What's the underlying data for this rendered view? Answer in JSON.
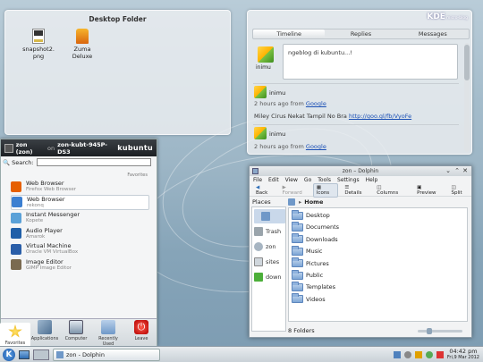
{
  "desktop_folder": {
    "title": "Desktop Folder",
    "icons": [
      {
        "label": "snapshot2.\npng",
        "name": "image-file-icon"
      },
      {
        "label": "Zuma Deluxe",
        "name": "zuma-icon"
      }
    ]
  },
  "twitter": {
    "brand": "KDE",
    "brand_sub": "micro-blog",
    "tabs": [
      "Timeline",
      "Replies",
      "Messages"
    ],
    "compose_placeholder": "ngeblog di kubuntu...!",
    "compose_user": "inimu",
    "posts": [
      {
        "user": "inimu",
        "meta_prefix": "2 hours ago from",
        "meta_source": "Google",
        "text": "Miley Cirus Nekat Tampil No Bra",
        "link": "http://goo.gl/fb/VyoFe"
      },
      {
        "user": "inimu",
        "meta_prefix": "2 hours ago from",
        "meta_source": "Google"
      }
    ]
  },
  "kickoff": {
    "user": "zon (zon)",
    "on": "on",
    "host": "zon-kubt-945P-DS3",
    "logo": "kubuntu",
    "search_label": "Search:",
    "section": "Favorites",
    "favorites": [
      {
        "title": "Web Browser",
        "sub": "Firefox Web Browser",
        "icon": "firefox-icon",
        "color": "#e66000"
      },
      {
        "title": "Web Browser",
        "sub": "rekonq",
        "icon": "rekonq-icon",
        "color": "#3b7fd1"
      },
      {
        "title": "Instant Messenger",
        "sub": "Kopete",
        "icon": "kopete-icon",
        "color": "#5aa1d8"
      },
      {
        "title": "Audio Player",
        "sub": "Amarok",
        "icon": "amarok-icon",
        "color": "#1f5fa8"
      },
      {
        "title": "Virtual Machine",
        "sub": "Oracle VM VirtualBox",
        "icon": "virtualbox-icon",
        "color": "#2a5ea8"
      },
      {
        "title": "Image Editor",
        "sub": "GIMP Image Editor",
        "icon": "gimp-icon",
        "color": "#7a6a50"
      }
    ],
    "tabs": [
      {
        "label": "Favorites",
        "icon": "star-icon"
      },
      {
        "label": "Applications",
        "icon": "applications-icon"
      },
      {
        "label": "Computer",
        "icon": "computer-icon"
      },
      {
        "label": "Recently Used",
        "icon": "folder-recent-icon"
      },
      {
        "label": "Leave",
        "icon": "power-icon"
      }
    ]
  },
  "dolphin": {
    "title": "zon – Dolphin",
    "menu": [
      "File",
      "Edit",
      "View",
      "Go",
      "Tools",
      "Settings",
      "Help"
    ],
    "toolbar": [
      "Back",
      "Forward",
      "Icons",
      "Details",
      "Columns",
      "Preview",
      "Split"
    ],
    "places_label": "Places",
    "breadcrumb": "Home",
    "places": [
      {
        "label": "",
        "icon": "home-place-icon"
      },
      {
        "label": "Trash",
        "icon": "trash-icon"
      },
      {
        "label": "zon",
        "icon": "user-folder-icon"
      },
      {
        "label": "sites",
        "icon": "network-icon"
      },
      {
        "label": "down",
        "icon": "download-icon"
      }
    ],
    "folders": [
      "Desktop",
      "Documents",
      "Downloads",
      "Music",
      "Pictures",
      "Public",
      "Templates",
      "Videos"
    ],
    "status": "8 Folders"
  },
  "taskbar": {
    "task": "zon - Dolphin",
    "time": "04:42 pm",
    "date": "Fri,9 Mar 2012"
  }
}
